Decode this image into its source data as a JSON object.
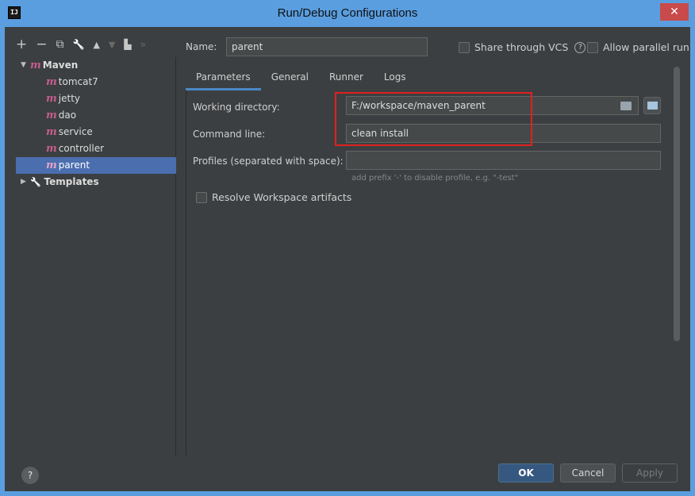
{
  "window": {
    "title": "Run/Debug Configurations",
    "app_icon": "IJ",
    "close_glyph": "✕"
  },
  "toolbar": {
    "add": "+",
    "remove": "−",
    "copy": "⧉",
    "edit": "🔧",
    "up": "▲",
    "down": "▼",
    "folder": "▙",
    "more": "»"
  },
  "tree": {
    "maven": {
      "label": "Maven",
      "arrow": "▼"
    },
    "items": [
      {
        "label": "tomcat7"
      },
      {
        "label": "jetty"
      },
      {
        "label": "dao"
      },
      {
        "label": "service"
      },
      {
        "label": "controller"
      },
      {
        "label": "parent"
      }
    ],
    "templates": {
      "label": "Templates",
      "arrow": "▶",
      "icon": "🔧"
    },
    "m_glyph": "m"
  },
  "form": {
    "name_label": "Name:",
    "name_value": "parent",
    "share_label": "Share through VCS",
    "help_glyph": "?",
    "allow_label": "Allow parallel run"
  },
  "tabs": [
    {
      "label": "Parameters"
    },
    {
      "label": "General"
    },
    {
      "label": "Runner"
    },
    {
      "label": "Logs"
    }
  ],
  "params": {
    "working_dir_label": "Working directory:",
    "working_dir_value": "F:/workspace/maven_parent",
    "command_line_label": "Command line:",
    "command_line_value": "clean install",
    "profiles_label": "Profiles (separated with space):",
    "profiles_value": "",
    "profiles_hint": "add prefix '-' to disable profile, e.g. \"-test\"",
    "resolve_label": "Resolve Workspace artifacts"
  },
  "buttons": {
    "ok": "OK",
    "cancel": "Cancel",
    "apply": "Apply",
    "help": "?"
  },
  "colors": {
    "accent": "#4a88c7",
    "selection": "#4b6eaf",
    "highlight": "#e02020",
    "maven": "#c65c8e"
  }
}
